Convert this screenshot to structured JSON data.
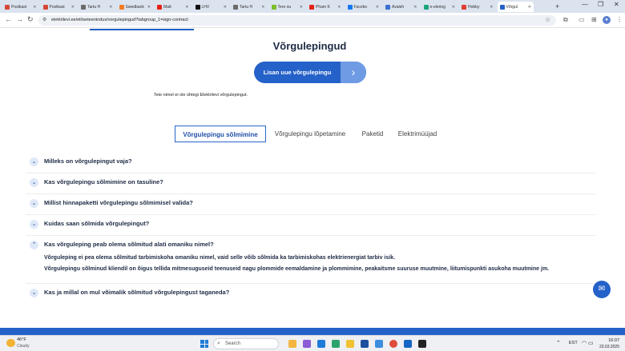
{
  "browser": {
    "tabs": [
      {
        "label": "Postkast",
        "color": "#d64937"
      },
      {
        "label": "Postkast",
        "color": "#d64937"
      },
      {
        "label": "Tartu H",
        "color": "#6a6a6a"
      },
      {
        "label": "Swedbank",
        "color": "#f47b20"
      },
      {
        "label": "Matt",
        "color": "#e62117"
      },
      {
        "label": "LHV",
        "color": "#111111"
      },
      {
        "label": "Tartu H",
        "color": "#6a6a6a"
      },
      {
        "label": "Tere ou",
        "color": "#7bbf2a"
      },
      {
        "label": "Pham K",
        "color": "#e62117"
      },
      {
        "label": "Facebo",
        "color": "#1877f2"
      },
      {
        "label": "Avaleh",
        "color": "#3b6fd0"
      },
      {
        "label": "e-elering",
        "color": "#1ba67a"
      },
      {
        "label": "Hobby",
        "color": "#e03c31"
      },
      {
        "label": "Võrgul",
        "color": "#2461c9",
        "active": true
      }
    ],
    "new_tab_icon": "plus-icon",
    "url": "elektrilevi.ee/et/iseteenindus/vorgulepingud?tabgroup_1=sign-contract"
  },
  "page": {
    "title": "Võrgulepingud",
    "add_button": "Lisan uue võrgulepingu",
    "notice": "Teie nimel ei ole ühtegi Elektrilevi võrgulepingut.",
    "tabs": [
      "Võrgulepingu sõlmimine",
      "Võrgulepingu lõpetamine",
      "Paketid",
      "Elektrimüüjad"
    ],
    "active_tab": "Võrgulepingu sõlmimine",
    "faq": [
      {
        "question": "Milleks on võrgulepingut vaja?",
        "open": false
      },
      {
        "question": "Kas võrgulepingu sõlmimine on tasuline?",
        "open": false
      },
      {
        "question": "Millist hinnapaketti võrgulepingu sõlmimisel valida?",
        "open": false
      },
      {
        "question": "Kuidas saan sõlmida võrgulepingut?",
        "open": false
      },
      {
        "question": "Kas võrguleping peab olema sõlmitud alati omaniku nimel?",
        "open": true
      },
      {
        "question": "Kas ja millal on mul võimalik sõlmitud võrgulepingust taganeda?",
        "open": false
      }
    ],
    "answer_lines": [
      "Võrguleping ei pea olema sõlmitud tarbimiskoha omaniku nimel, vaid selle võib sõlmida ka tarbimiskohas elektrienergiat tarbiv isik.",
      "Võrgulepingu sõlminud kliendil on õigus tellida mitmesuguseid teenuseid nagu plommide eemaldamine ja plommimine, peakaitsme suuruse muutmine, liitumispunkti asukoha muutmine jm."
    ]
  },
  "taskbar": {
    "weather_temp": "46°F",
    "weather_desc": "Cloudy",
    "search_placeholder": "Search",
    "lang": "EST",
    "time": "16:07",
    "date": "23.03.2025"
  }
}
